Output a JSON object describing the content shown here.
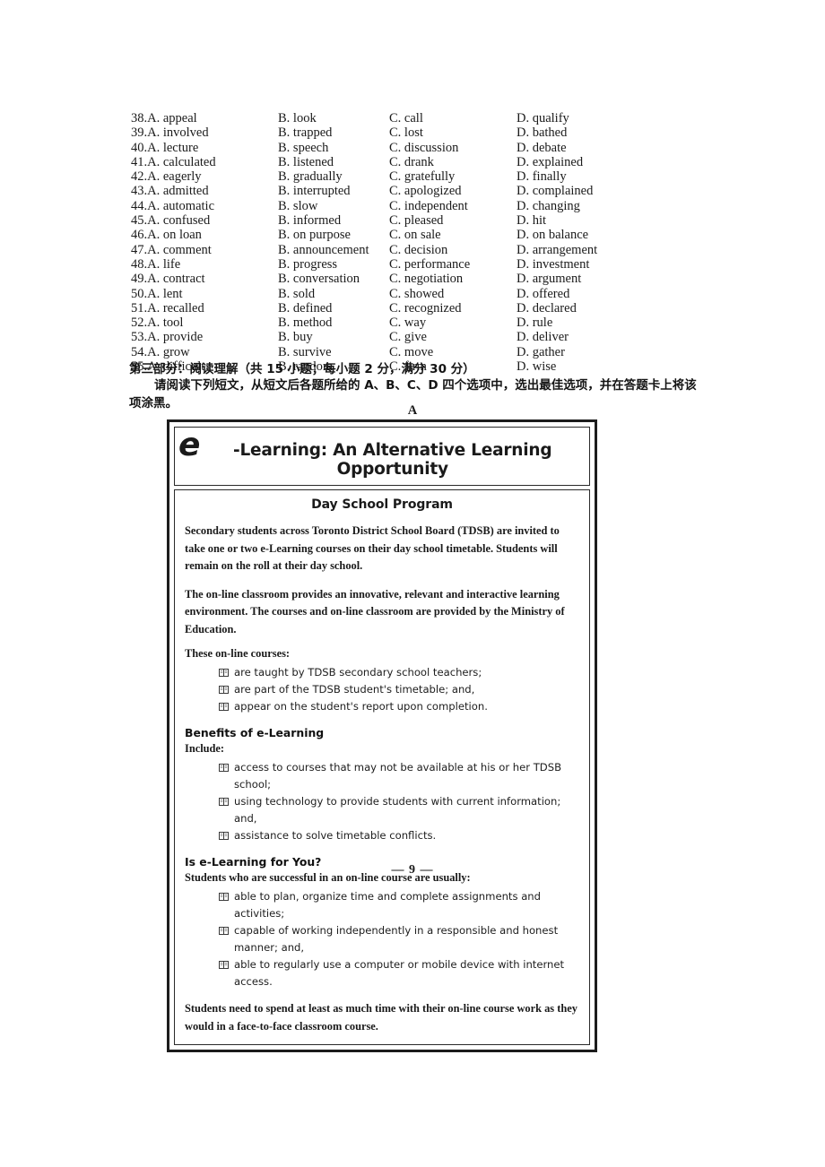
{
  "cloze": {
    "columns": [
      "A",
      "B",
      "C",
      "D"
    ],
    "rows": [
      {
        "num": "38.",
        "a": "A. appeal",
        "b": "B. look",
        "c": "C. call",
        "d": "D. qualify"
      },
      {
        "num": "39.",
        "a": "A. involved",
        "b": "B. trapped",
        "c": "C. lost",
        "d": "D. bathed"
      },
      {
        "num": "40.",
        "a": "A. lecture",
        "b": "B. speech",
        "c": "C. discussion",
        "d": "D. debate"
      },
      {
        "num": "41.",
        "a": "A. calculated",
        "b": "B. listened",
        "c": "C. drank",
        "d": "D. explained"
      },
      {
        "num": "42.",
        "a": "A. eagerly",
        "b": "B. gradually",
        "c": "C. gratefully",
        "d": "D. finally"
      },
      {
        "num": "43.",
        "a": "A. admitted",
        "b": "B. interrupted",
        "c": "C. apologized",
        "d": "D. complained"
      },
      {
        "num": "44.",
        "a": "A. automatic",
        "b": "B. slow",
        "c": "C. independent",
        "d": "D. changing"
      },
      {
        "num": "45.",
        "a": "A. confused",
        "b": "B. informed",
        "c": "C. pleased",
        "d": "D. hit"
      },
      {
        "num": "46.",
        "a": "A. on loan",
        "b": "B. on purpose",
        "c": "C. on sale",
        "d": "D. on balance"
      },
      {
        "num": "47.",
        "a": "A. comment",
        "b": "B. announcement",
        "c": "C. decision",
        "d": "D. arrangement"
      },
      {
        "num": "48.",
        "a": "A. life",
        "b": "B. progress",
        "c": "C. performance",
        "d": "D. investment"
      },
      {
        "num": "49.",
        "a": "A. contract",
        "b": "B. conversation",
        "c": "C. negotiation",
        "d": "D. argument"
      },
      {
        "num": "50.",
        "a": "A. lent",
        "b": "B. sold",
        "c": "C. showed",
        "d": "D. offered"
      },
      {
        "num": "51.",
        "a": "A. recalled",
        "b": "B. defined",
        "c": "C. recognized",
        "d": "D. declared"
      },
      {
        "num": "52.",
        "a": "A. tool",
        "b": "B. method",
        "c": "C. way",
        "d": "D. rule"
      },
      {
        "num": "53.",
        "a": "A. provide",
        "b": "B. buy",
        "c": "C. give",
        "d": "D. deliver"
      },
      {
        "num": "54.",
        "a": "A. grow",
        "b": "B. survive",
        "c": "C. move",
        "d": "D. gather"
      },
      {
        "num": "55.",
        "a": "A. difficult",
        "b": "B. random",
        "c": "C. firm",
        "d": "D. wise"
      }
    ]
  },
  "section": {
    "heading": "第三部分：阅读理解（共 15 小题；每小题 2 分，满分 30 分）",
    "instruction": "请阅读下列短文，从短文后各题所给的 A、B、C、D 四个选项中，选出最佳选项，并在答题卡上将该项涂黑。",
    "passage_label": "A"
  },
  "passage": {
    "title_e": "e",
    "title_rest": "-Learning: An Alternative Learning Opportunity",
    "program_header": "Day School Program",
    "para1": "Secondary students across Toronto District School Board (TDSB) are invited to take one or two e-Learning courses on their day school timetable. Students will remain on the roll at their day school.",
    "para2": "The on-line classroom provides an innovative, relevant and interactive learning environment. The courses and on-line classroom are provided by the Ministry of Education.",
    "courses_lead": "These on-line courses:",
    "courses_bullets": [
      "are taught by TDSB secondary school teachers;",
      "are part of the TDSB student's timetable; and,",
      "appear on the student's report upon completion."
    ],
    "benefits_heading": "Benefits of e-Learning",
    "benefits_lead": "Include:",
    "benefits_bullets": [
      "access to courses that may not be available at his or her TDSB school;",
      "using technology to provide students with current information; and,",
      "assistance to solve timetable conflicts."
    ],
    "suitability_heading": "Is e-Learning for You?",
    "suitability_lead": "Students who are successful in an on-line course are usually:",
    "suitability_bullets": [
      "able to plan, organize time and complete assignments and activities;",
      "capable of working independently in a responsible and honest manner; and,",
      "able to regularly use a computer or mobile device with internet access."
    ],
    "closing": "Students need to spend at least as much time with their on-line course work as they would in a face-to-face classroom course.",
    "bullet_icon": "open-book-icon"
  },
  "footer": {
    "page_number": "— 9 —"
  }
}
